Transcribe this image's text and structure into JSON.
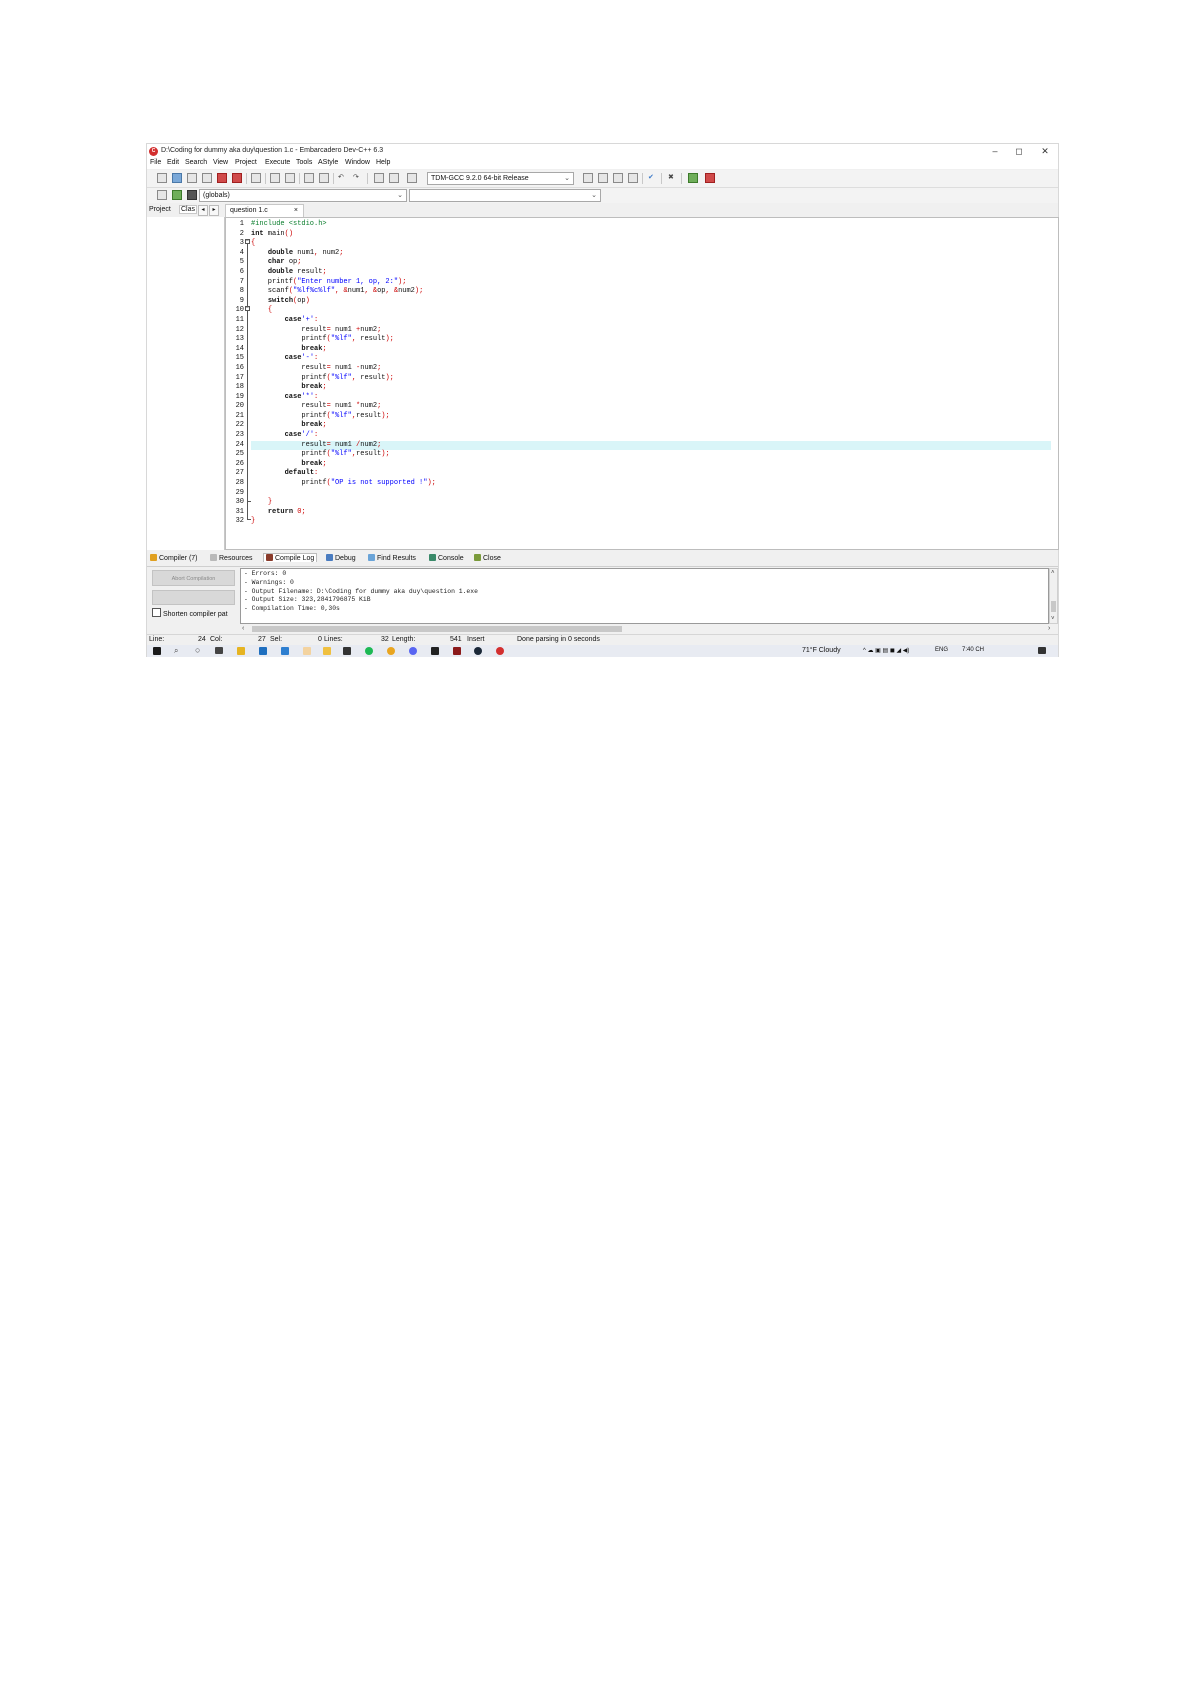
{
  "window": {
    "title": "D:\\Coding for dummy aka duy\\question 1.c - Embarcadero Dev-C++ 6.3",
    "icon": "devcpp-logo-icon",
    "controls": [
      "–",
      "◻",
      "✕"
    ]
  },
  "menu": [
    "File",
    "Edit",
    "Search",
    "View",
    "Project",
    "Execute",
    "Tools",
    "AStyle",
    "Window",
    "Help"
  ],
  "toolbar": {
    "compiler_select": "TDM-GCC 9.2.0 64-bit Release",
    "scope_select": "(globals)",
    "function_select": ""
  },
  "left_panel": {
    "tabs": [
      "Project",
      "Clas"
    ]
  },
  "editor": {
    "tab_label": "question 1.c",
    "tab_close": "×",
    "highlighted_line": 24,
    "lines": [
      {
        "n": "1",
        "t": "#include <stdio.h>"
      },
      {
        "n": "2",
        "t": "int main()"
      },
      {
        "n": "3",
        "t": "{"
      },
      {
        "n": "4",
        "t": "    double num1, num2;"
      },
      {
        "n": "5",
        "t": "    char op;"
      },
      {
        "n": "6",
        "t": "    double result;"
      },
      {
        "n": "7",
        "t": "    printf(\"Enter number 1, op, 2:\");"
      },
      {
        "n": "8",
        "t": "    scanf(\"%lf%c%lf\", &num1, &op, &num2);"
      },
      {
        "n": "9",
        "t": "    switch(op)"
      },
      {
        "n": "10",
        "t": "    {"
      },
      {
        "n": "11",
        "t": "        case'+':"
      },
      {
        "n": "12",
        "t": "            result= num1 +num2;"
      },
      {
        "n": "13",
        "t": "            printf(\"%lf\", result);"
      },
      {
        "n": "14",
        "t": "            break;"
      },
      {
        "n": "15",
        "t": "        case'-':"
      },
      {
        "n": "16",
        "t": "            result= num1 -num2;"
      },
      {
        "n": "17",
        "t": "            printf(\"%lf\", result);"
      },
      {
        "n": "18",
        "t": "            break;"
      },
      {
        "n": "19",
        "t": "        case'*':"
      },
      {
        "n": "20",
        "t": "            result= num1 *num2;"
      },
      {
        "n": "21",
        "t": "            printf(\"%lf\",result);"
      },
      {
        "n": "22",
        "t": "            break;"
      },
      {
        "n": "23",
        "t": "        case'/':"
      },
      {
        "n": "24",
        "t": "            result= num1 /num2;"
      },
      {
        "n": "25",
        "t": "            printf(\"%lf\",result);"
      },
      {
        "n": "26",
        "t": "            break;"
      },
      {
        "n": "27",
        "t": "        default:"
      },
      {
        "n": "28",
        "t": "            printf(\"OP is not supported !\");"
      },
      {
        "n": "29",
        "t": ""
      },
      {
        "n": "30",
        "t": "    }"
      },
      {
        "n": "31",
        "t": "    return 0;"
      },
      {
        "n": "32",
        "t": "}"
      }
    ]
  },
  "bottom_panel": {
    "tabs": [
      "Compiler (7)",
      "Resources",
      "Compile Log",
      "Debug",
      "Find Results",
      "Console",
      "Close"
    ],
    "active_tab": "Compile Log",
    "abort_button": "Abort Compilation",
    "shorten_checkbox": "Shorten compiler pat",
    "log": [
      "- Errors: 0",
      "- Warnings: 0",
      "- Output Filename: D:\\Coding for dummy aka duy\\question 1.exe",
      "- Output Size: 323,2841796875 KiB",
      "- Compilation Time: 0,30s"
    ]
  },
  "status_bar": {
    "line_label": "Line:",
    "line_value": "24",
    "col_label": "Col:",
    "col_value": "27",
    "sel_label": "Sel:",
    "sel_value": "0",
    "lines_label": "Lines:",
    "lines_value": "32",
    "length_label": "Length:",
    "length_value": "541",
    "mode": "Insert",
    "message": "Done parsing in 0 seconds"
  },
  "taskbar": {
    "weather": "71°F Cloudy",
    "language": "ENG",
    "time": "7:40 CH"
  },
  "colors": {
    "keyword": "#111111",
    "preprocessor": "#0a7d2c",
    "string": "#0000ff",
    "symbol": "#cc0000",
    "current_line": "#d9f5f8"
  }
}
